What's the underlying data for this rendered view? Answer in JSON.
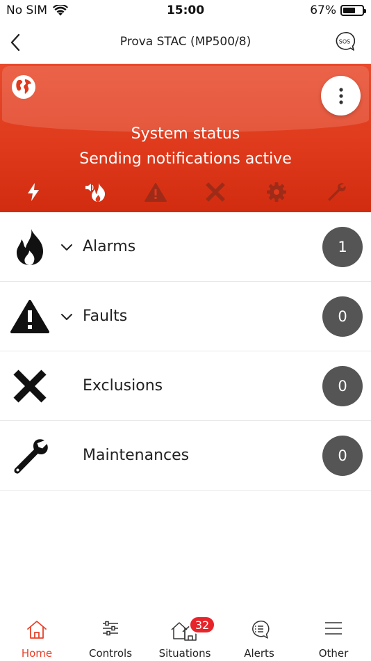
{
  "status_bar": {
    "carrier": "No SIM",
    "time": "15:00",
    "battery_percent": "67%",
    "battery_level": 0.67
  },
  "nav": {
    "title": "Prova STAC (MP500/8)",
    "back_icon": "chevron-left-icon",
    "sos_icon": "sos-chat-icon"
  },
  "panel": {
    "background": "#df3a1c",
    "title": "System status",
    "subtitle": "Sending notifications active",
    "status_icons": [
      {
        "name": "power-icon",
        "active": true
      },
      {
        "name": "fire-alarm-icon",
        "active": true
      },
      {
        "name": "warning-icon",
        "active": false
      },
      {
        "name": "exclusion-icon",
        "active": false
      },
      {
        "name": "gear-icon",
        "active": false
      },
      {
        "name": "wrench-icon",
        "active": false
      }
    ]
  },
  "list": {
    "rows": [
      {
        "icon": "flame-icon",
        "label": "Alarms",
        "count": "1",
        "expandable": true
      },
      {
        "icon": "warning-icon",
        "label": "Faults",
        "count": "0",
        "expandable": true
      },
      {
        "icon": "x-icon",
        "label": "Exclusions",
        "count": "0",
        "expandable": false
      },
      {
        "icon": "wrench-icon",
        "label": "Maintenances",
        "count": "0",
        "expandable": false
      }
    ]
  },
  "tabbar": {
    "accent": "#e8412a",
    "tabs": [
      {
        "label": "Home",
        "icon": "home-icon",
        "active": true
      },
      {
        "label": "Controls",
        "icon": "sliders-icon",
        "active": false
      },
      {
        "label": "Situations",
        "icon": "houses-icon",
        "active": false
      },
      {
        "label": "Alerts",
        "icon": "chat-list-icon",
        "active": false,
        "badge": "32"
      },
      {
        "label": "Other",
        "icon": "menu-icon",
        "active": false
      }
    ]
  }
}
